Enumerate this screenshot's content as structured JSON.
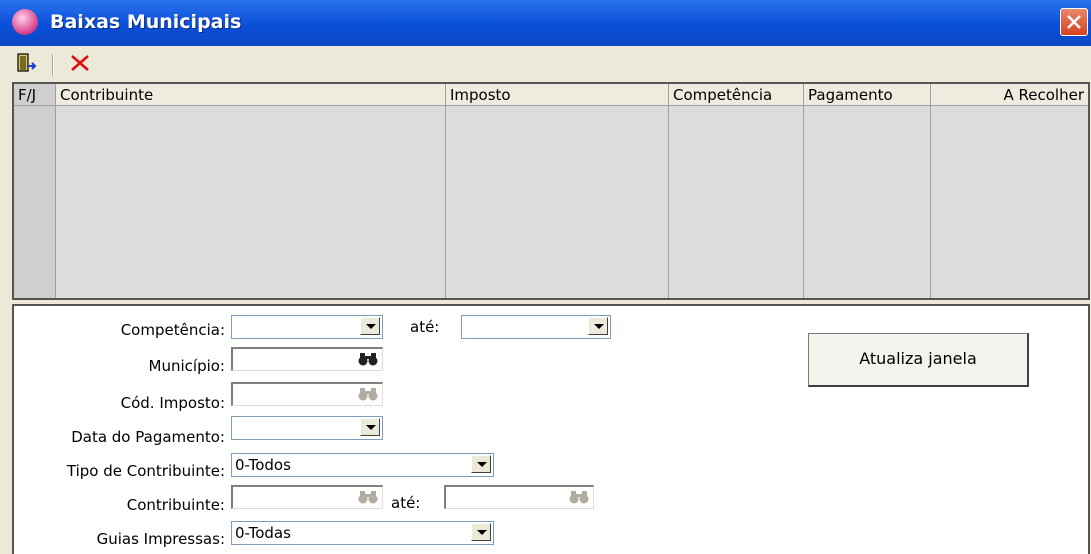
{
  "window": {
    "title": "Baixas Municipais"
  },
  "toolbar": {
    "exit_icon": "door-exit-icon",
    "delete_icon": "red-x-icon"
  },
  "grid": {
    "columns": [
      "F/J",
      "Contribuinte",
      "Imposto",
      "Competência",
      "Pagamento",
      "A Recolher"
    ],
    "rows": []
  },
  "form": {
    "competencia_label": "Competência:",
    "ate_label": "até:",
    "municipio_label": "Município:",
    "cod_imposto_label": "Cód. Imposto:",
    "data_pagamento_label": "Data do Pagamento:",
    "tipo_contribuinte_label": "Tipo de Contribuinte:",
    "tipo_contribuinte_value": "0-Todos",
    "contribuinte_label": "Contribuinte:",
    "contribuinte_ate_label": "até:",
    "guias_label": "Guias Impressas:",
    "guias_value": "0-Todas",
    "refresh_button": "Atualiza janela"
  },
  "colors": {
    "titlebar": "#0a4fd8",
    "window_bg": "#ece9d8",
    "grid_bg": "#dcdcdc",
    "close_button": "#d5411c"
  }
}
